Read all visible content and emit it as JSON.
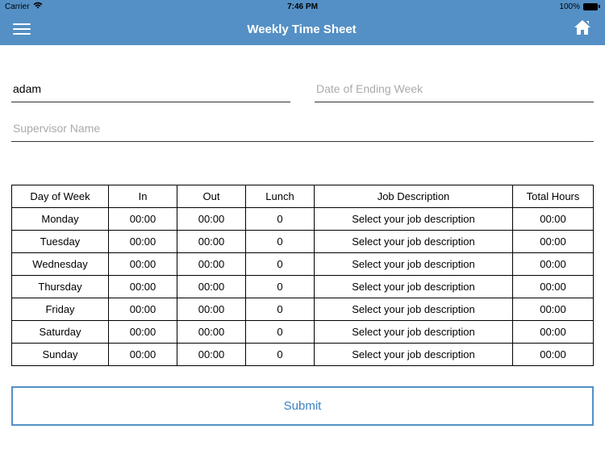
{
  "status": {
    "carrier": "Carrier",
    "time": "7:46 PM",
    "battery": "100%"
  },
  "nav": {
    "title": "Weekly Time Sheet"
  },
  "form": {
    "name_value": "adam",
    "date_placeholder": "Date of Ending Week",
    "supervisor_placeholder": "Supervisor Name"
  },
  "table": {
    "headers": {
      "day": "Day of Week",
      "in": "In",
      "out": "Out",
      "lunch": "Lunch",
      "job": "Job Description",
      "total": "Total Hours"
    },
    "rows": [
      {
        "day": "Monday",
        "in": "00:00",
        "out": "00:00",
        "lunch": "0",
        "job": "Select your job description",
        "total": "00:00"
      },
      {
        "day": "Tuesday",
        "in": "00:00",
        "out": "00:00",
        "lunch": "0",
        "job": "Select your job description",
        "total": "00:00"
      },
      {
        "day": "Wednesday",
        "in": "00:00",
        "out": "00:00",
        "lunch": "0",
        "job": "Select your job description",
        "total": "00:00"
      },
      {
        "day": "Thursday",
        "in": "00:00",
        "out": "00:00",
        "lunch": "0",
        "job": "Select your job description",
        "total": "00:00"
      },
      {
        "day": "Friday",
        "in": "00:00",
        "out": "00:00",
        "lunch": "0",
        "job": "Select your job description",
        "total": "00:00"
      },
      {
        "day": "Saturday",
        "in": "00:00",
        "out": "00:00",
        "lunch": "0",
        "job": "Select your job description",
        "total": "00:00"
      },
      {
        "day": "Sunday",
        "in": "00:00",
        "out": "00:00",
        "lunch": "0",
        "job": "Select your job description",
        "total": "00:00"
      }
    ]
  },
  "submit_label": "Submit"
}
